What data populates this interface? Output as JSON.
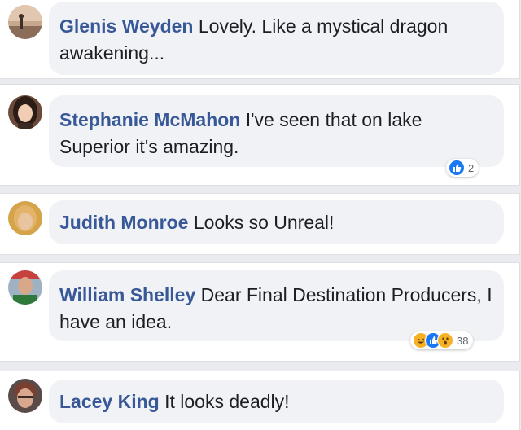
{
  "comments": [
    {
      "author": "Glenis Weyden",
      "text": "Lovely. Like a mystical dragon awakening..."
    },
    {
      "author": "Stephanie McMahon",
      "text": "I've seen that on lake Superior it's amazing.",
      "reactions": {
        "icons": [
          "like-icon"
        ],
        "count": "2"
      }
    },
    {
      "author": "Judith Monroe",
      "text": "Looks so Unreal!"
    },
    {
      "author": "William Shelley",
      "text": "Dear Final Destination Producers, I have an idea.",
      "reactions": {
        "icons": [
          "haha-icon",
          "like-icon",
          "wow-icon"
        ],
        "count": "38"
      }
    },
    {
      "author": "Lacey King",
      "text": "It looks deadly!"
    }
  ],
  "colors": {
    "author": "#385898",
    "bubble": "#f0f2f5",
    "like": "#1877f2",
    "haha": "#f7b125"
  }
}
